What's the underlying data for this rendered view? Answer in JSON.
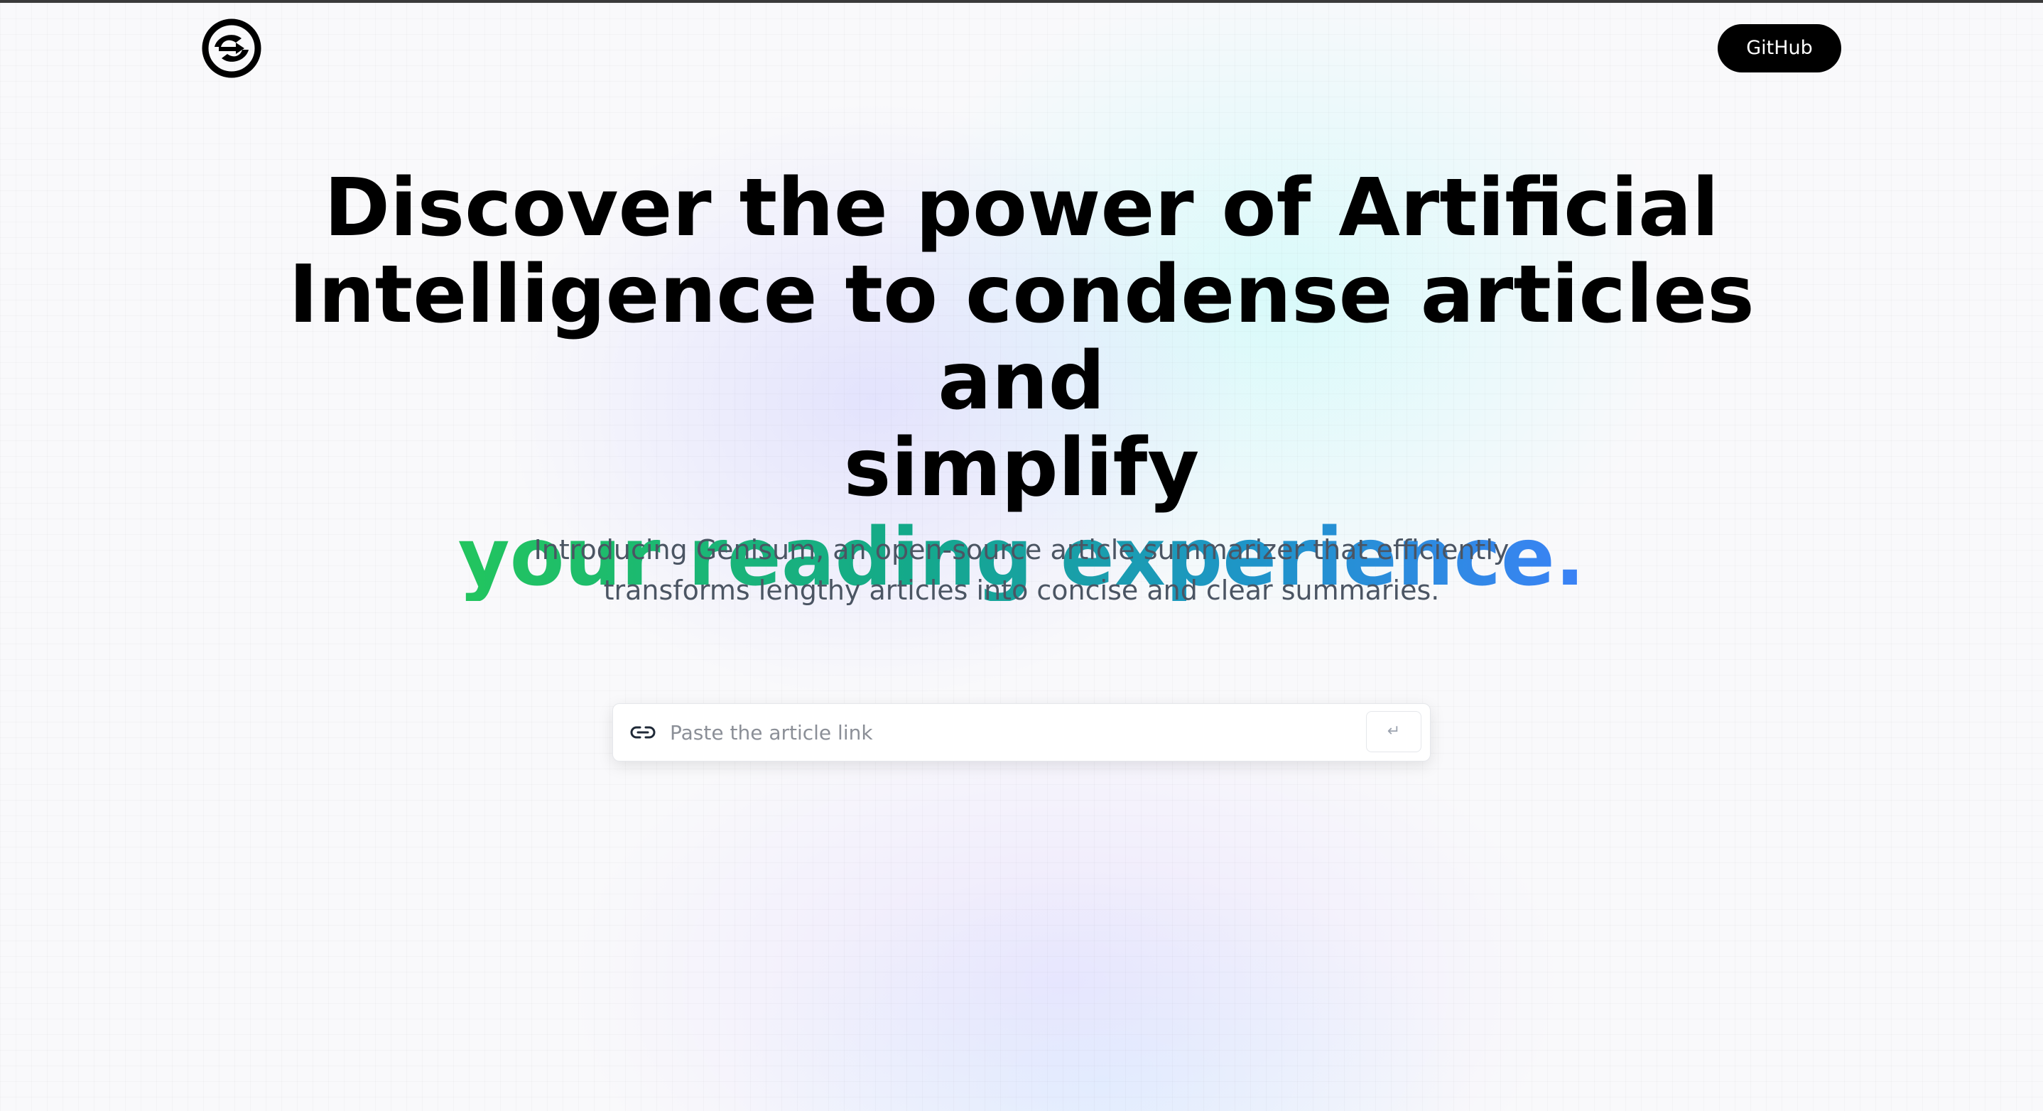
{
  "header": {
    "logo_icon": "genisum-logo-icon",
    "github_label": "GitHub"
  },
  "hero": {
    "headline_line1": "Discover the power of Artificial",
    "headline_line2": "Intelligence to condense articles and",
    "headline_line3": "simplify",
    "headline_highlight": "your reading experience.",
    "highlight_gradient": [
      "#22c55e",
      "#3b82f6"
    ],
    "subtitle_line1": "Introducing Genisum, an open-source article summarizer that efficiently",
    "subtitle_line2": "transforms lengthy articles into concise and clear summaries."
  },
  "search": {
    "icon": "link-icon",
    "placeholder": "Paste the article link",
    "value": "",
    "submit_label": "↵"
  },
  "colors": {
    "button_bg": "#000000",
    "text": "#000000",
    "subtitle": "#4b5563"
  }
}
